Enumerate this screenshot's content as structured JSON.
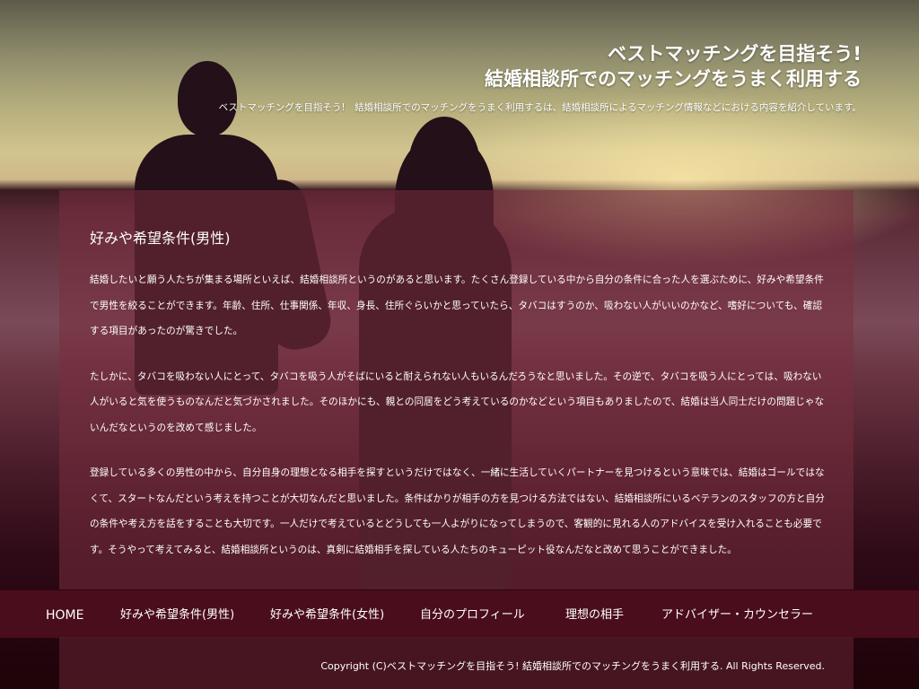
{
  "header": {
    "title_line1": "ベストマッチングを目指そう!",
    "title_line2": "結婚相談所でのマッチングをうまく利用する",
    "description": "ベストマッチングを目指そう!　結婚相談所でのマッチングをうまく利用するは、結婚相談所によるマッチング情報などにおける内容を紹介しています。"
  },
  "main": {
    "section_title": "好みや希望条件(男性)",
    "paragraphs": [
      "結婚したいと願う人たちが集まる場所といえば、結婚相談所というのがあると思います。たくさん登録している中から自分の条件に合った人を選ぶために、好みや希望条件で男性を絞ることができます。年齢、住所、仕事関係、年収、身長、住所ぐらいかと思っていたら、タバコはすうのか、吸わない人がいいのかなど、嗜好についても、確認する項目があったのが驚きでした。",
      "たしかに、タバコを吸わない人にとって、タバコを吸う人がそばにいると耐えられない人もいるんだろうなと思いました。その逆で、タバコを吸う人にとっては、吸わない人がいると気を使うものなんだと気づかされました。そのほかにも、親との同居をどう考えているのかなどという項目もありましたので、結婚は当人同士だけの問題じゃないんだなというのを改めて感じました。",
      "登録している多くの男性の中から、自分自身の理想となる相手を探すというだけではなく、一緒に生活していくパートナーを見つけるという意味では、結婚はゴールではなくて、スタートなんだという考えを持つことが大切なんだと思いました。条件ばかりが相手の方を見つける方法ではない、結婚相談所にいるベテランのスタッフの方と自分の条件や考え方を話をすることも大切です。一人だけで考えているとどうしても一人よがりになってしまうので、客観的に見れる人のアドバイスを受け入れることも必要です。そうやって考えてみると、結婚相談所というのは、真剣に結婚相手を探している人たちのキューピット役なんだなと改めて思うことができました。"
    ]
  },
  "nav": {
    "items": [
      "HOME",
      "好みや希望条件(男性)",
      "好みや希望条件(女性)",
      "自分のプロフィール",
      "理想の相手",
      "アドバイザー・カウンセラー"
    ]
  },
  "footer": {
    "copyright": "Copyright (C)ベストマッチングを目指そう! 結婚相談所でのマッチングをうまく利用する.  All Rights Reserved."
  }
}
